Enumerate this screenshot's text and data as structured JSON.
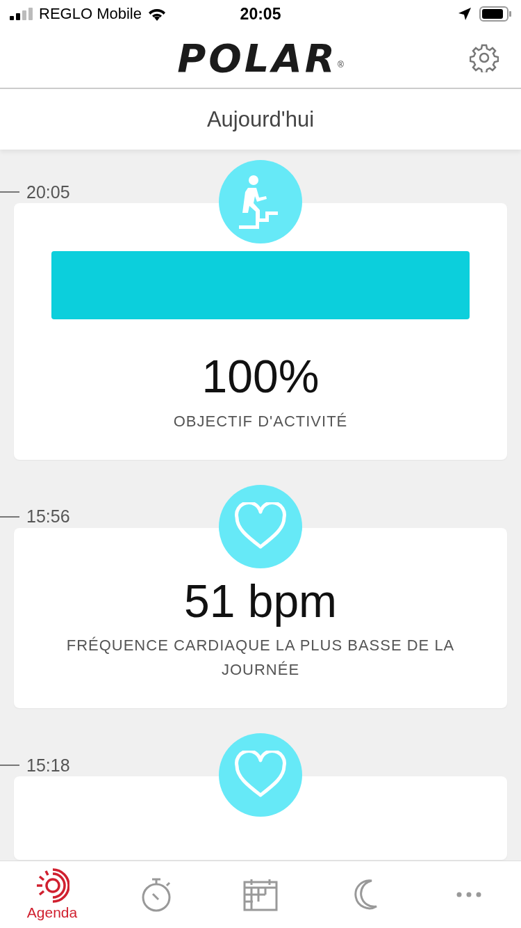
{
  "status_bar": {
    "carrier": "REGLO Mobile",
    "time": "20:05"
  },
  "header": {
    "logo": "POLAR",
    "registered": "®"
  },
  "title": "Aujourd'hui",
  "feed": [
    {
      "time": "20:05",
      "kind": "activity",
      "level": 1,
      "value": "100%",
      "label": "OBJECTIF D'ACTIVITÉ"
    },
    {
      "time": "15:56",
      "kind": "heart",
      "value": "51 bpm",
      "label": "FRÉQUENCE CARDIAQUE LA PLUS BASSE DE LA JOURNÉE"
    },
    {
      "time": "15:18",
      "kind": "heart"
    }
  ],
  "tabs": [
    {
      "kind": "agenda",
      "label": "Agenda",
      "selected": true
    },
    {
      "kind": "training",
      "selected": false
    },
    {
      "kind": "calendar",
      "selected": false
    },
    {
      "kind": "sleep",
      "selected": false
    },
    {
      "kind": "more",
      "selected": false
    }
  ]
}
